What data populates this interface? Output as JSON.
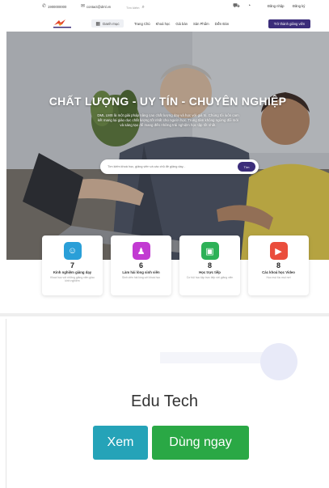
{
  "topbar": {
    "phone": "1900000000",
    "email": "contact@dml.vn",
    "search_placeholder": "Tìm kiếm",
    "login": "Đăng nhập",
    "register": "Đăng ký"
  },
  "navbar": {
    "menu_label": "Danh mục",
    "links": [
      "Trang Chủ",
      "Khoá học",
      "Giá bán",
      "Sản Phẩm",
      "Diễn Đàn"
    ],
    "cta": "Trở thành giảng viên"
  },
  "hero": {
    "title": "CHẤT LƯỢNG - UY TÍN - CHUYÊN NGHIỆP",
    "description": "DML LMS là một giải pháp nâng cao chất lượng dạy và học với giá trị. Chúng tôi luôn cam kết mang lại giáo dục chất lượng tốt nhất cho người học. Trung tâm không ngừng đổi mới và sáng tạo để mang đến những trải nghiệm học tập tốt nhất.",
    "search_placeholder": "Tìm kiếm khoá học, giảng viên và các chủ đề giảng dạy...",
    "search_button": "Tìm"
  },
  "stats": [
    {
      "value": "7",
      "label": "Kinh nghiệm giảng dạy",
      "desc": "Khoá học với những giảng viên giàu kinh nghiệm",
      "color": "#2a9fd8",
      "icon": "teacher-icon"
    },
    {
      "value": "6",
      "label": "Làm hài lòng sinh viên",
      "desc": "Sinh viên hài lòng với khoá học",
      "color": "#c23ad2",
      "icon": "student-icon"
    },
    {
      "value": "8",
      "label": "Học trực tiếp",
      "desc": "Cơ hội học tập trực tiếp với giảng viên",
      "color": "#2db157",
      "icon": "classroom-icon"
    },
    {
      "value": "8",
      "label": "Các khoá học Video",
      "desc": "Học mọi lúc mọi nơi",
      "color": "#ea4d3c",
      "icon": "video-icon"
    }
  ],
  "bottom": {
    "brand": "Edu Tech",
    "view_button": "Xem",
    "use_button": "Dùng ngay"
  }
}
